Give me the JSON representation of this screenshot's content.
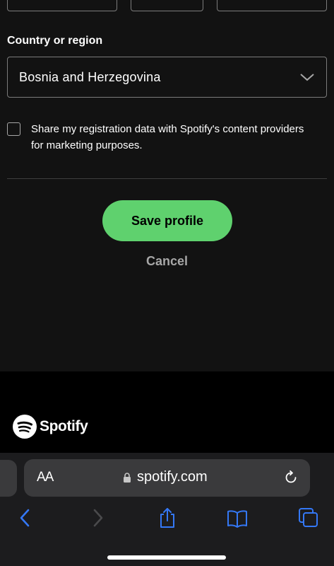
{
  "form": {
    "country_label": "Country or region",
    "country_value": "Bosnia and Herzegovina",
    "share_checkbox_checked": false,
    "share_text": "Share my registration data with Spotify's content providers for marketing purposes.",
    "save_label": "Save profile",
    "cancel_label": "Cancel"
  },
  "footer": {
    "logo_text": "Spotify"
  },
  "browser": {
    "text_size_label": "AA",
    "domain": "spotify.com"
  },
  "colors": {
    "background": "#121212",
    "accent": "#5fd16e",
    "ios_blue": "#3478f6"
  },
  "icons": [
    "chevron-down-icon",
    "lock-icon",
    "reload-icon",
    "back-icon",
    "forward-icon",
    "share-icon",
    "bookmarks-icon",
    "tabs-icon",
    "spotify-logo-icon"
  ]
}
